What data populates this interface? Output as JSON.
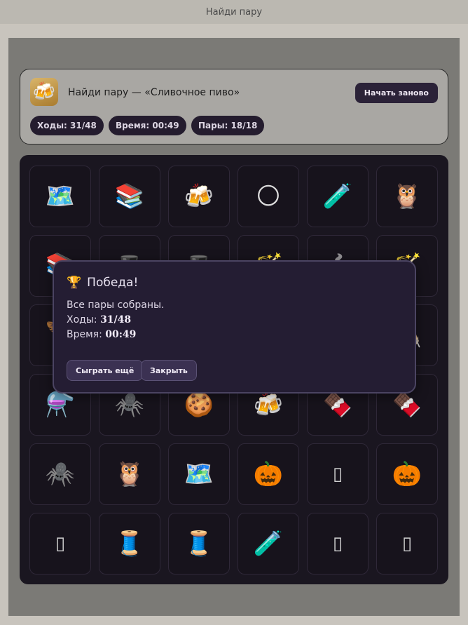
{
  "window": {
    "title": "Найди пару"
  },
  "header": {
    "app_icon": "beer-mugs-icon",
    "title": "Найди пару — «Сливочное пиво»",
    "restart_label": "Начать заново",
    "stats": {
      "moves": "Ходы: 31/48",
      "time": "Время: 00:49",
      "pairs": "Пары: 18/18"
    }
  },
  "board": {
    "cards": [
      {
        "icon": "map-icon",
        "glyph": "🗺️"
      },
      {
        "icon": "books-icon",
        "glyph": "📚"
      },
      {
        "icon": "beer-mugs-icon",
        "glyph": "🍻"
      },
      {
        "icon": "moon-icon",
        "glyph": "🌕"
      },
      {
        "icon": "test-tube-icon",
        "glyph": "🧪"
      },
      {
        "icon": "owl-icon",
        "glyph": "🦉"
      },
      {
        "icon": "books-icon",
        "glyph": "📚"
      },
      {
        "icon": "hat-icon",
        "glyph": "🎩"
      },
      {
        "icon": "hat-icon",
        "glyph": "🎩"
      },
      {
        "icon": "wand-icon",
        "glyph": "🪄"
      },
      {
        "icon": "pot-icon",
        "glyph": "🍲"
      },
      {
        "icon": "wand-icon",
        "glyph": "🪄"
      },
      {
        "icon": "feather-icon",
        "glyph": "🪶"
      },
      {
        "icon": "unknown-icon",
        "glyph": ""
      },
      {
        "icon": "unknown-icon",
        "glyph": ""
      },
      {
        "icon": "unknown-icon",
        "glyph": ""
      },
      {
        "icon": "unknown-icon",
        "glyph": ""
      },
      {
        "icon": "feather-icon",
        "glyph": "🪶"
      },
      {
        "icon": "potion-flask-icon",
        "glyph": "⚗️"
      },
      {
        "icon": "spider-icon",
        "glyph": "🕷️"
      },
      {
        "icon": "cookie-icon",
        "glyph": "🍪"
      },
      {
        "icon": "beer-mugs-icon",
        "glyph": "🍻"
      },
      {
        "icon": "chocolate-bar-icon",
        "glyph": "🍫"
      },
      {
        "icon": "chocolate-bar-icon",
        "glyph": "🍫"
      },
      {
        "icon": "spider-icon",
        "glyph": "🕷️"
      },
      {
        "icon": "owl-icon",
        "glyph": "🦉"
      },
      {
        "icon": "map-icon",
        "glyph": "🗺️"
      },
      {
        "icon": "pumpkin-icon",
        "glyph": "🎃"
      },
      {
        "icon": "missing-glyph-icon",
        "glyph": "▯"
      },
      {
        "icon": "pumpkin-icon",
        "glyph": "🎃"
      },
      {
        "icon": "missing-glyph-icon",
        "glyph": "▯"
      },
      {
        "icon": "thread-spool-icon",
        "glyph": "🧵"
      },
      {
        "icon": "thread-spool-icon",
        "glyph": "🧵"
      },
      {
        "icon": "test-tube-icon",
        "glyph": "🧪"
      },
      {
        "icon": "missing-glyph-icon",
        "glyph": "▯"
      },
      {
        "icon": "missing-glyph-icon",
        "glyph": "▯"
      }
    ]
  },
  "modal": {
    "trophy_icon": "trophy-icon",
    "trophy_glyph": "🏆",
    "title": "Победа!",
    "message": "Все пары собраны.",
    "moves_label": "Ходы:",
    "moves_value": "31/48",
    "time_label": "Время:",
    "time_value": "00:49",
    "play_again_label": "Сыграть ещё",
    "close_label": "Закрыть"
  },
  "colors": {
    "accent_dark": "#2b2238",
    "board_bg": "#1a1620",
    "modal_bg": "#241d33",
    "trophy": "#e6b422"
  }
}
